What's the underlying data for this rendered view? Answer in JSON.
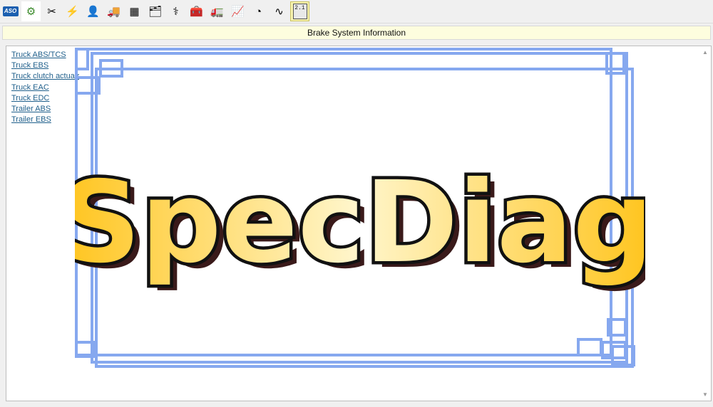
{
  "toolbar": {
    "items": [
      {
        "name": "aso-icon",
        "label": "ASO"
      },
      {
        "name": "gear-info-icon"
      },
      {
        "name": "tools-info-icon"
      },
      {
        "name": "wiring-info-icon"
      },
      {
        "name": "technician-info-icon"
      },
      {
        "name": "truck-info-icon"
      },
      {
        "name": "engine-info-icon"
      },
      {
        "name": "folder-map-icon"
      },
      {
        "name": "stethoscope-icon"
      },
      {
        "name": "toolbox-icon"
      },
      {
        "name": "truck-document-icon"
      },
      {
        "name": "chart-icon"
      },
      {
        "name": "gauge-icon"
      },
      {
        "name": "oscilloscope-icon"
      },
      {
        "name": "calculator-icon",
        "label": "2.1"
      }
    ],
    "selected_index": 1
  },
  "header": {
    "title": "Brake System Information"
  },
  "links": [
    "Truck ABS/TCS",
    "Truck EBS",
    "Truck clutch actuator",
    "Truck EAC",
    "Truck EDC",
    "Trailer ABS",
    "Trailer EBS"
  ],
  "logo": {
    "text": "SpecDiag"
  },
  "colors": {
    "frame": "#86a8ef",
    "gold": "#ffc820",
    "header_bg": "#fdfdde",
    "link": "#1f5f8b"
  }
}
